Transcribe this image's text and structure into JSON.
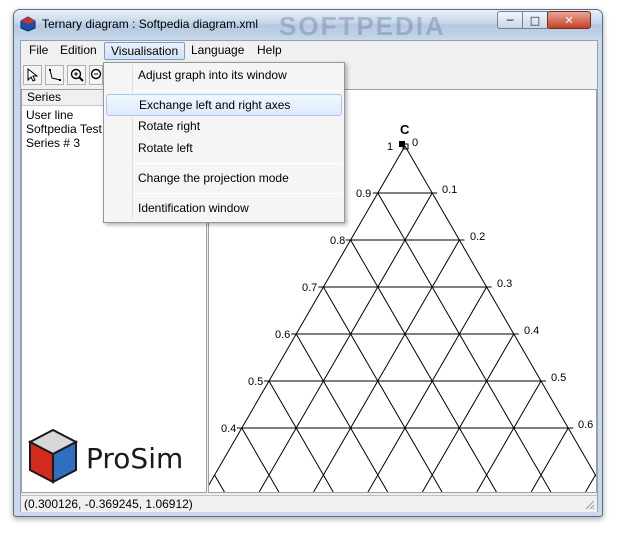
{
  "window": {
    "title": "Ternary diagram : Softpedia diagram.xml",
    "watermark": "SOFTPEDIA",
    "controls": {
      "minimize": "─",
      "maximize": "□",
      "close": "✕"
    }
  },
  "menubar": {
    "items": [
      {
        "label": "File"
      },
      {
        "label": "Edition"
      },
      {
        "label": "Visualisation"
      },
      {
        "label": "Language"
      },
      {
        "label": "Help"
      }
    ]
  },
  "toolbar": {
    "buttons": [
      {
        "icon": "pointer-icon"
      },
      {
        "icon": "polyline-icon"
      },
      {
        "icon": "zoom-in-icon"
      },
      {
        "icon": "zoom-out-icon"
      }
    ]
  },
  "series_panel": {
    "header": "Series",
    "items": [
      "User line",
      "Softpedia Test",
      "Series # 3"
    ]
  },
  "logo": {
    "text": "ProSim"
  },
  "visualisation_menu": {
    "items": [
      {
        "label": "Adjust graph into its window"
      },
      {
        "label": "Exchange left and right axes",
        "highlighted": true
      },
      {
        "label": "Rotate right"
      },
      {
        "label": "Rotate left"
      },
      {
        "label": "Change the projection mode"
      },
      {
        "label": "Identification window"
      }
    ]
  },
  "diagram": {
    "left_axis_labels": [
      "1",
      "0.9",
      "0.8",
      "0.7",
      "0.6",
      "0.5",
      "0.4"
    ],
    "right_axis_labels": [
      "0",
      "0.1",
      "0.2",
      "0.3",
      "0.4",
      "0.5",
      "0.6"
    ],
    "right_axis_label_top_mark": "C"
  },
  "status": {
    "coordinates": "(0.300126, -0.369245, 1.06912)"
  }
}
